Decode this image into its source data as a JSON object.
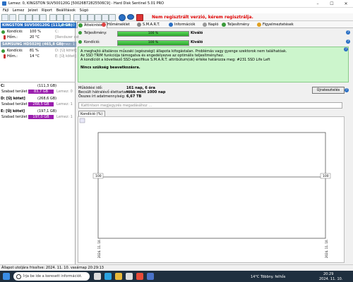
{
  "window": {
    "title": "Lemez: 0, KINGSTON SUV500120G [50026B72825506C9] - Hard Disk Sentinel 5.01 PRO",
    "controls": [
      "–",
      "☐",
      "✕"
    ]
  },
  "menu": [
    "Fájl",
    "Lemez",
    "Jelzet",
    "Riport",
    "Beállítások",
    "Súgó"
  ],
  "toolbar": {
    "reg_notice": "Nem regisztrált verzió, kérem regisztrálja."
  },
  "left": {
    "disk1": {
      "title": "KINGSTON SUV500120G (111,8 GB)",
      "tag": "Lemez: 0",
      "health_label": "Kondíció:",
      "health_value": "100 %",
      "health_extra": "C:",
      "temp_label": "Hőm.:",
      "temp_value": "20 °C",
      "temp_extra": "[Rendszer cst"
    },
    "disk2": {
      "title": "SAMSUNG HD502HJ (465,8 GB)",
      "tag": "Lemez: 1",
      "health_label": "Kondíció:",
      "health_value": "81 %",
      "health_extra": "D: [Új kötet]",
      "temp_label": "Hőm.:",
      "temp_value": "14 °C",
      "temp_extra": "E: [Új kötet]"
    },
    "volumes": [
      {
        "name": "C:",
        "size": "(111,3 GB)",
        "free_label": "Szabad terület",
        "free": "83,7 GB",
        "disk": "Lemez: 0",
        "color": "#9b1fae"
      },
      {
        "name": "D: [Új kötet]",
        "size": "(268,6 GB)",
        "free_label": "Szabad terület",
        "free": "268,5 GB",
        "disk": "Lemez: 1",
        "color": "#9b1fae"
      },
      {
        "name": "E: [Új kötet]",
        "size": "(197,1 GB)",
        "free_label": "Szabad terület",
        "free": "197,0 GB",
        "disk": "Lemez: 1",
        "color": "#9b1fae"
      }
    ]
  },
  "tabs": [
    "Áttekintés",
    "Hőmérséklet",
    "S.M.A.R.T.",
    "Információk",
    "Napló",
    "Teljesítmény",
    "Figyelmeztetések"
  ],
  "status": {
    "perf_label": "Teljesítmény:",
    "perf_value": "100 %",
    "perf_result": "Kiváló",
    "health_label": "Kondíció:",
    "health_value": "100 %",
    "health_result": "Kiváló"
  },
  "message": {
    "line1": "A meghajtó általános műszaki (egészségi) állapota kifogástalan. Problémás vagy gyenge szektorok nem találhatóak.",
    "line2": "Az SSD TRIM funkciója támogatva és engedélyezve az optimális teljesítményhez.",
    "line3": "A kondíciót a következő SSD-specifikus S.M.A.R.T. attribútum(ok) értéke határozza meg: #231 SSD Life Left",
    "warn": "Nincs szükség beavatkozásra."
  },
  "info": {
    "uptime_label": "Működési idő:",
    "uptime_value": "161 nap, 6 óra",
    "remaining_label": "Becsült hátralévő élettartam:",
    "remaining_value": "több mint 1000 nap",
    "written_label": "Összes írt adatmennyiség:",
    "written_value": "6,67 TB"
  },
  "update_button": "Újratesztelés",
  "comment_placeholder": "Kattintson megjegyzés megadásához ...",
  "subtab": "Kondíció (%)",
  "graph": {
    "left_label": "100",
    "right_label": "100",
    "date_left": "2024. 11. 10.",
    "date_right": "2024. 11. 10."
  },
  "chart_data": {
    "type": "line",
    "series": [
      {
        "values": [
          100,
          100
        ]
      }
    ],
    "x": [
      "2024. 11. 10.",
      "2024. 11. 10."
    ]
  },
  "statusbar": "Állapot utoljára frissítve: 2024. 11. 10. vasárnap 20:29:13",
  "taskbar": {
    "search": "Írja be ide a keresett információt.",
    "weather": "14°C  Többny. felhős",
    "time": "20:29",
    "date": "2024. 11. 10."
  },
  "colors": {
    "disk_header": "#2a6fc4",
    "disk_header_inactive": "#6f8aa8",
    "ok_green": "#3a9a3a",
    "msg_bg": "#ccf5cc",
    "reg_red": "#e00000"
  }
}
